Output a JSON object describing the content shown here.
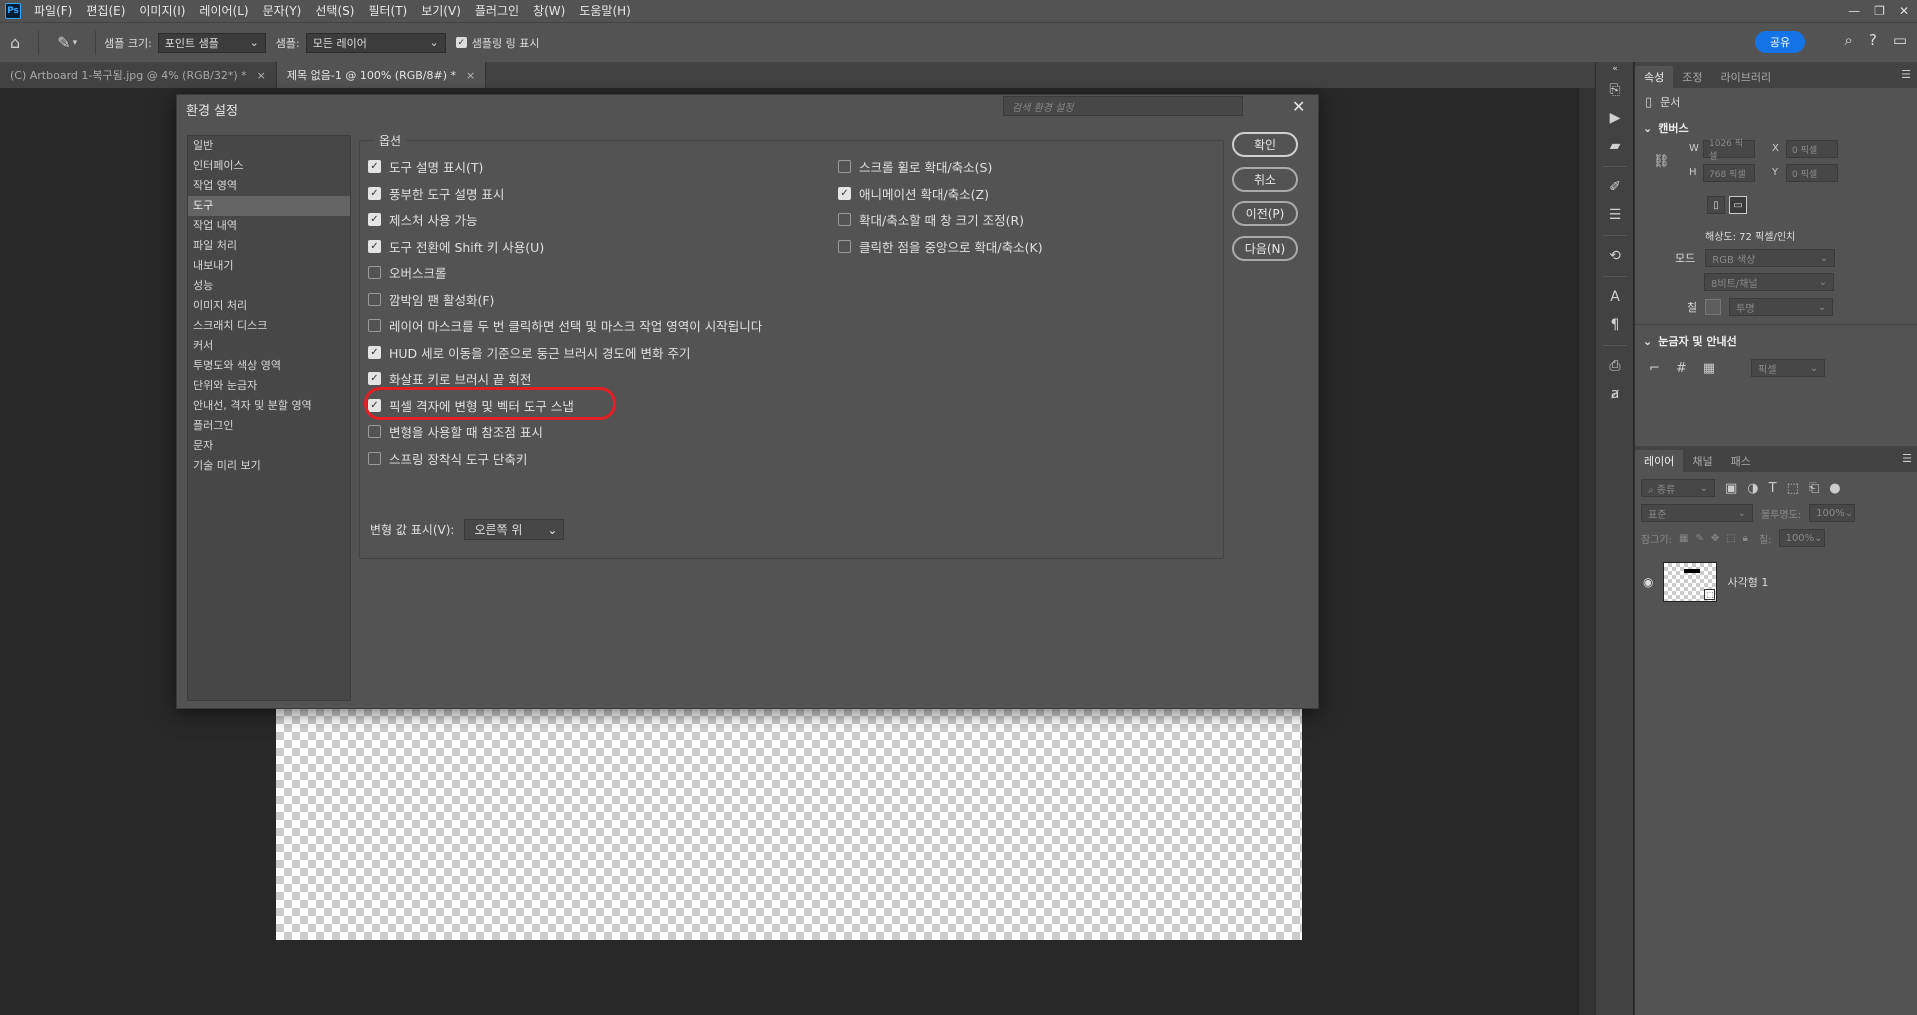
{
  "app": {
    "logo": "Ps",
    "menus": [
      "파일(F)",
      "편집(E)",
      "이미지(I)",
      "레이어(L)",
      "문자(Y)",
      "선택(S)",
      "필터(T)",
      "보기(V)",
      "플러그인",
      "창(W)",
      "도움말(H)"
    ],
    "window_controls": [
      "—",
      "❐",
      "✕"
    ]
  },
  "options_bar": {
    "sample_size_label": "샘플 크기:",
    "sample_size_value": "포인트 샘플",
    "sample_label": "샘플:",
    "sample_value": "모든 레이어",
    "show_ring_label": "샘플링 링 표시",
    "share_label": "공유"
  },
  "tabs": [
    {
      "label": "(C) Artboard 1-복구됨.jpg @ 4% (RGB/32*) *",
      "close": "×"
    },
    {
      "label": "제목 없음-1 @ 100% (RGB/8#) *",
      "close": "×"
    }
  ],
  "dialog": {
    "title": "환경 설정",
    "search_placeholder": "검색 환경 설정",
    "close": "✕",
    "nav_items": [
      "일반",
      "인터페이스",
      "작업 영역",
      "도구",
      "작업 내역",
      "파일 처리",
      "내보내기",
      "성능",
      "이미지 처리",
      "스크래치 디스크",
      "커서",
      "투명도와 색상 영역",
      "단위와 눈금자",
      "안내선, 격자 및 분할 영역",
      "플러그인",
      "문자",
      "기술 미리 보기"
    ],
    "selected_nav": "도구",
    "options_legend": "옵션",
    "left_options": [
      {
        "label": "도구 설명 표시(T)",
        "checked": true
      },
      {
        "label": "풍부한 도구 설명 표시",
        "checked": true
      },
      {
        "label": "제스처 사용 가능",
        "checked": true
      },
      {
        "label": "도구 전환에 Shift 키 사용(U)",
        "checked": true
      },
      {
        "label": "오버스크롤",
        "checked": false
      },
      {
        "label": "깜박임 팬 활성화(F)",
        "checked": false
      },
      {
        "label": "레이어 마스크를 두 번 클릭하면 선택 및 마스크 작업 영역이 시작됩니다",
        "checked": false
      },
      {
        "label": "HUD 세로 이동을 기준으로 둥근 브러시 경도에 변화 주기",
        "checked": true
      },
      {
        "label": "화살표 키로 브러시 끝 회전",
        "checked": true
      },
      {
        "label": "픽셀 격자에 변형 및 벡터 도구 스냅",
        "checked": true
      },
      {
        "label": "변형을 사용할 때 참조점 표시",
        "checked": false
      },
      {
        "label": "스프링 장착식 도구 단축키",
        "checked": false
      }
    ],
    "right_options": [
      {
        "label": "스크롤 휠로 확대/축소(S)",
        "checked": false
      },
      {
        "label": "애니메이션 확대/축소(Z)",
        "checked": true
      },
      {
        "label": "확대/축소할 때 창 크기 조정(R)",
        "checked": false
      },
      {
        "label": "클릭한 점을 중앙으로 확대/축소(K)",
        "checked": false
      }
    ],
    "transform_label": "변형 값 표시(V):",
    "transform_value": "오른쪽 위",
    "buttons": {
      "ok": "확인",
      "cancel": "취소",
      "prev": "이전(P)",
      "next": "다음(N)"
    }
  },
  "panels": {
    "top_tabs": [
      "속성",
      "조정",
      "라이브러리"
    ],
    "doc_label": "문서",
    "canvas_title": "캔버스",
    "w_label": "W",
    "w_value": "1026 픽셀",
    "h_label": "H",
    "h_value": "768 픽셀",
    "x_label": "X",
    "x_value": "0 픽셀",
    "y_label": "Y",
    "y_value": "0 픽셀",
    "resolution": "해상도: 72 픽셀/인치",
    "mode_label": "모드",
    "mode_value": "RGB 색상",
    "depth_value": "8비트/채널",
    "fill_label": "칠",
    "fill_value": "투명",
    "rulers_title": "눈금자 및 안내선",
    "units_value": "픽셀",
    "layer_tabs": [
      "레이어",
      "채널",
      "패스"
    ],
    "kind_label": "종류",
    "blend_value": "표준",
    "opacity_label": "불투명도:",
    "opacity_value": "100%",
    "lock_label": "잠그기:",
    "fill2_label": "칠:",
    "fill2_value": "100%",
    "layer_name": "사각형 1"
  }
}
